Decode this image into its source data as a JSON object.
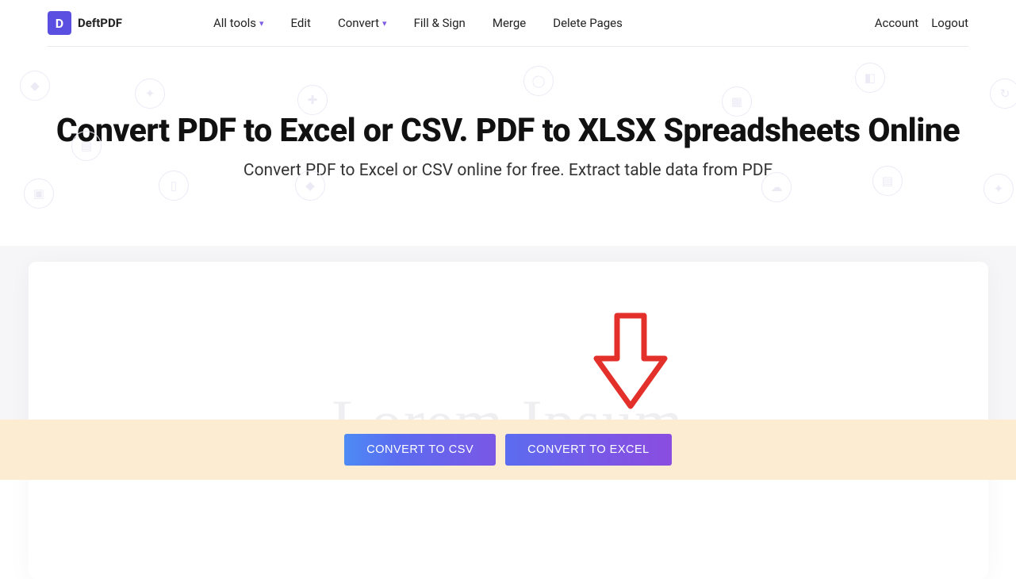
{
  "brand": {
    "logo_letter": "D",
    "name": "DeftPDF"
  },
  "nav": {
    "all_tools": "All tools",
    "edit": "Edit",
    "convert": "Convert",
    "fill_sign": "Fill & Sign",
    "merge": "Merge",
    "delete_pages": "Delete Pages",
    "account": "Account",
    "logout": "Logout"
  },
  "hero": {
    "title": "Convert PDF to Excel or CSV. PDF to XLSX Spreadsheets Online",
    "subtitle": "Convert PDF to Excel or CSV online for free. Extract table data from PDF"
  },
  "watermark": "Lorem Ipsum",
  "buttons": {
    "to_csv": "CONVERT TO CSV",
    "to_excel": "CONVERT TO EXCEL"
  }
}
